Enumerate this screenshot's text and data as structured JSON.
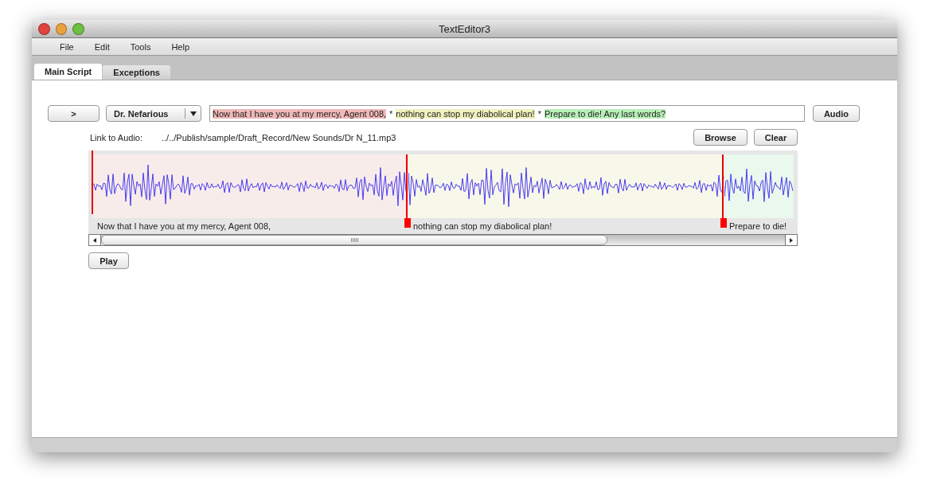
{
  "window": {
    "title": "TextEditor3"
  },
  "menu": [
    "File",
    "Edit",
    "Tools",
    "Help"
  ],
  "tabs": [
    {
      "label": "Main Script",
      "selected": true
    },
    {
      "label": "Exceptions",
      "selected": false
    }
  ],
  "toolbar": {
    "next_button": ">",
    "character": "Dr. Nefarious",
    "audio_button": "Audio",
    "script_segments": [
      {
        "text": "Now that I have you at my mercy, Agent 008,",
        "color": "#f0b8b8",
        "separator_after": "*"
      },
      {
        "text": "nothing can stop my diabolical plan!",
        "color": "#f0f0bc",
        "separator_after": "*"
      },
      {
        "text": "Prepare to die! Any last words?",
        "color": "#b8f0b8"
      }
    ]
  },
  "audio_link": {
    "label": "Link to Audio:",
    "path": "../../Publish/sample/Draft_Record/New Sounds/Dr N_11.mp3",
    "buttons": [
      "Browse",
      "Clear"
    ]
  },
  "waveform": {
    "segments": [
      {
        "label": "Now that I have you at my mercy, Agent 008,",
        "color": "#f8eceb"
      },
      {
        "label": "nothing can stop my diabolical plan!",
        "color": "#f8f8ea"
      },
      {
        "label": "Prepare to die!",
        "color": "#eaf8ee"
      }
    ]
  },
  "play_button": "Play"
}
